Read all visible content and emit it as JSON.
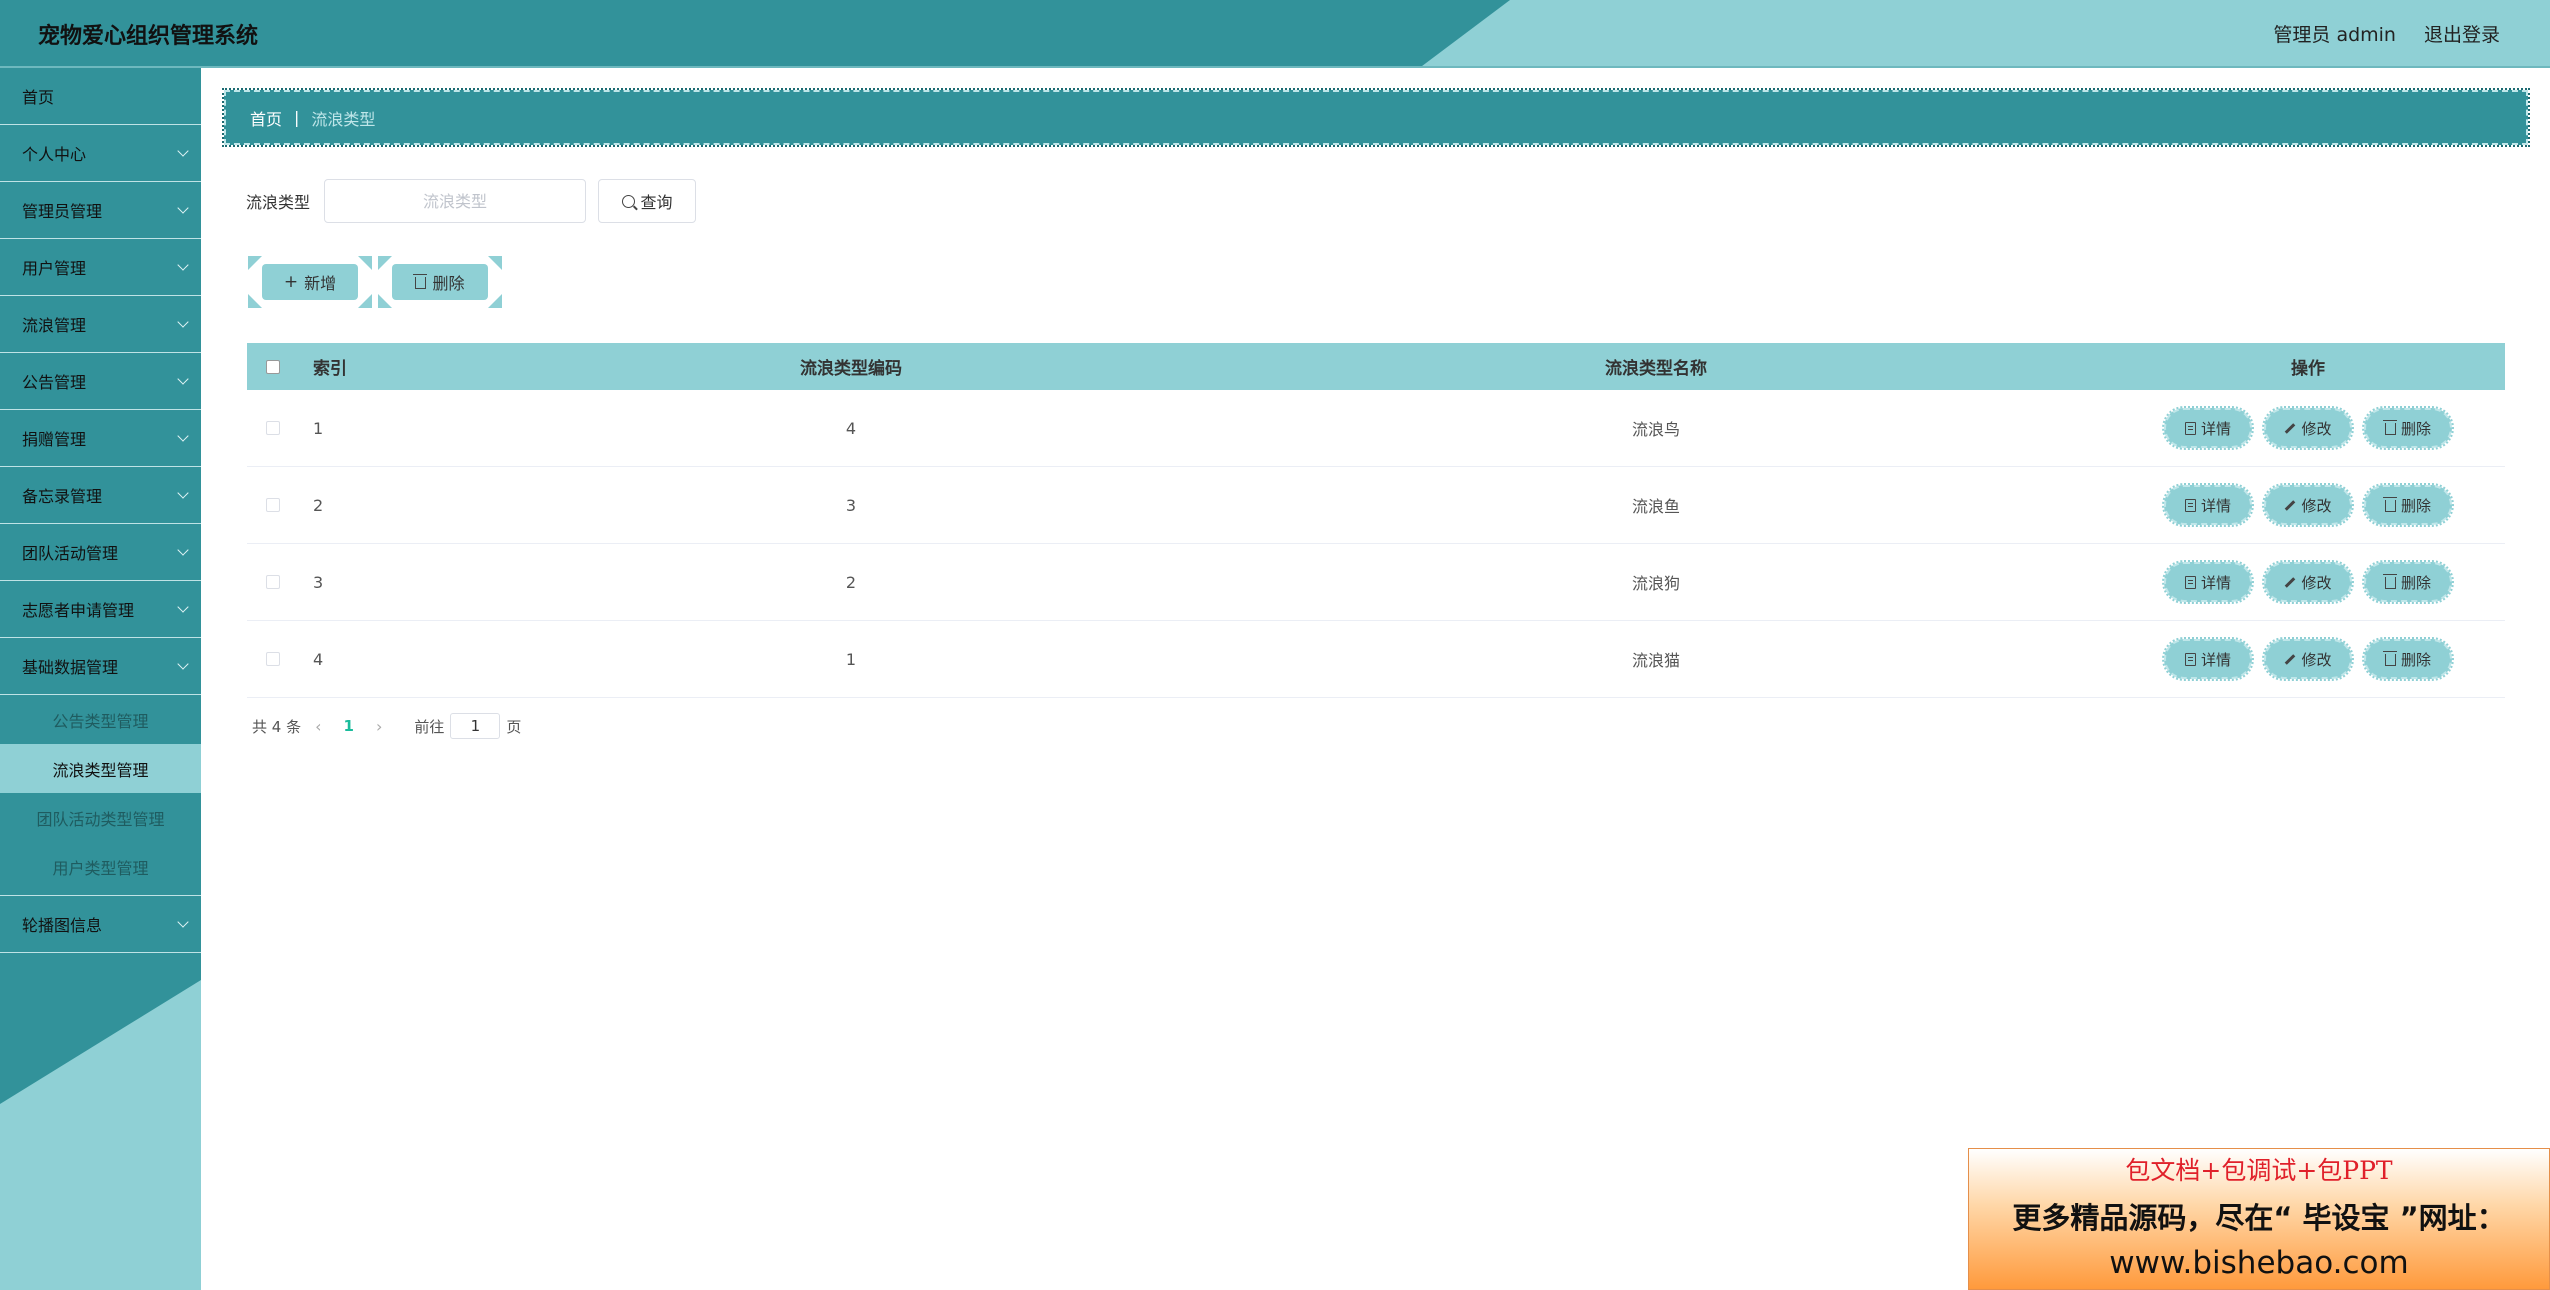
{
  "header": {
    "app_title": "宠物爱心组织管理系统",
    "user_label": "管理员 admin",
    "logout_label": "退出登录"
  },
  "sidebar": {
    "items": [
      {
        "label": "首页",
        "chevron": false
      },
      {
        "label": "个人中心",
        "chevron": true
      },
      {
        "label": "管理员管理",
        "chevron": true
      },
      {
        "label": "用户管理",
        "chevron": true
      },
      {
        "label": "流浪管理",
        "chevron": true
      },
      {
        "label": "公告管理",
        "chevron": true
      },
      {
        "label": "捐赠管理",
        "chevron": true
      },
      {
        "label": "备忘录管理",
        "chevron": true
      },
      {
        "label": "团队活动管理",
        "chevron": true
      },
      {
        "label": "志愿者申请管理",
        "chevron": true
      },
      {
        "label": "基础数据管理",
        "chevron": true
      }
    ],
    "submenu": [
      {
        "label": "公告类型管理",
        "active": false
      },
      {
        "label": "流浪类型管理",
        "active": true
      },
      {
        "label": "团队活动类型管理",
        "active": false
      },
      {
        "label": "用户类型管理",
        "active": false
      }
    ],
    "last_item": {
      "label": "轮播图信息"
    }
  },
  "breadcrumb": {
    "home": "首页",
    "separator": "|",
    "current": "流浪类型"
  },
  "search": {
    "label": "流浪类型",
    "placeholder": "流浪类型",
    "value": "",
    "query_label": "查询"
  },
  "actions": {
    "add_label": "新增",
    "delete_label": "删除"
  },
  "table": {
    "headers": {
      "index": "索引",
      "code": "流浪类型编码",
      "name": "流浪类型名称",
      "ops": "操作"
    },
    "rows": [
      {
        "index": "1",
        "code": "4",
        "name": "流浪鸟"
      },
      {
        "index": "2",
        "code": "3",
        "name": "流浪鱼"
      },
      {
        "index": "3",
        "code": "2",
        "name": "流浪狗"
      },
      {
        "index": "4",
        "code": "1",
        "name": "流浪猫"
      }
    ],
    "row_actions": {
      "detail": "详情",
      "edit": "修改",
      "delete": "删除"
    }
  },
  "pagination": {
    "total_text": "共 4 条",
    "prev": "‹",
    "current_page": "1",
    "next": "›",
    "goto_label": "前往",
    "goto_value": "1",
    "page_suffix": "页"
  },
  "ad": {
    "line1": "包文档+包调试+包PPT",
    "line2": "更多精品源码，尽在“ 毕设宝 ”网址：",
    "line3": "www.bishebao.com"
  },
  "colors": {
    "primary_dark": "#32929a",
    "primary_light": "#8fd0d5",
    "page_active": "#1abc9c"
  }
}
